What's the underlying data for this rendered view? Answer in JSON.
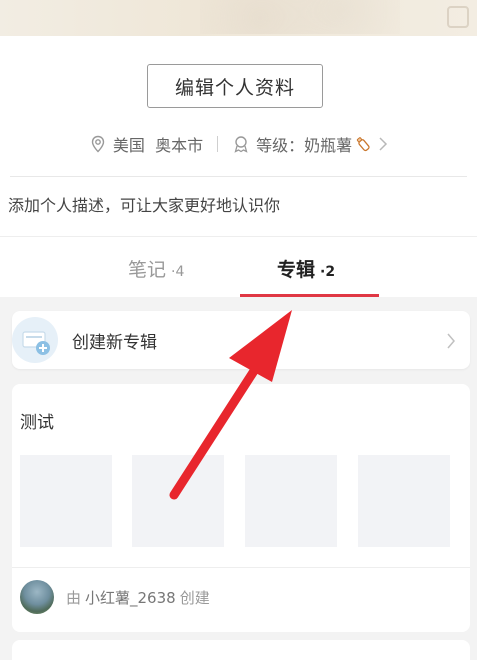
{
  "profile": {
    "edit_button": "编辑个人资料",
    "location": "美国  奥本市",
    "level": "等级：奶瓶薯",
    "description_placeholder": "添加个人描述，可让大家更好地认识你"
  },
  "tabs": [
    {
      "label": "笔记",
      "count": "·4",
      "active": false
    },
    {
      "label": "专辑",
      "count": "·2",
      "active": true
    }
  ],
  "create_album": {
    "label": "创建新专辑"
  },
  "album": {
    "title": "测试",
    "creator_prefix": "由",
    "creator_name": "小红薯_2638",
    "creator_suffix": "创建"
  },
  "colors": {
    "accent": "#e03744",
    "arrow": "#e8262d"
  },
  "icons": [
    "location-pin-icon",
    "level-badge-icon",
    "bottle-icon",
    "chevron-right-icon",
    "album-add-icon"
  ]
}
